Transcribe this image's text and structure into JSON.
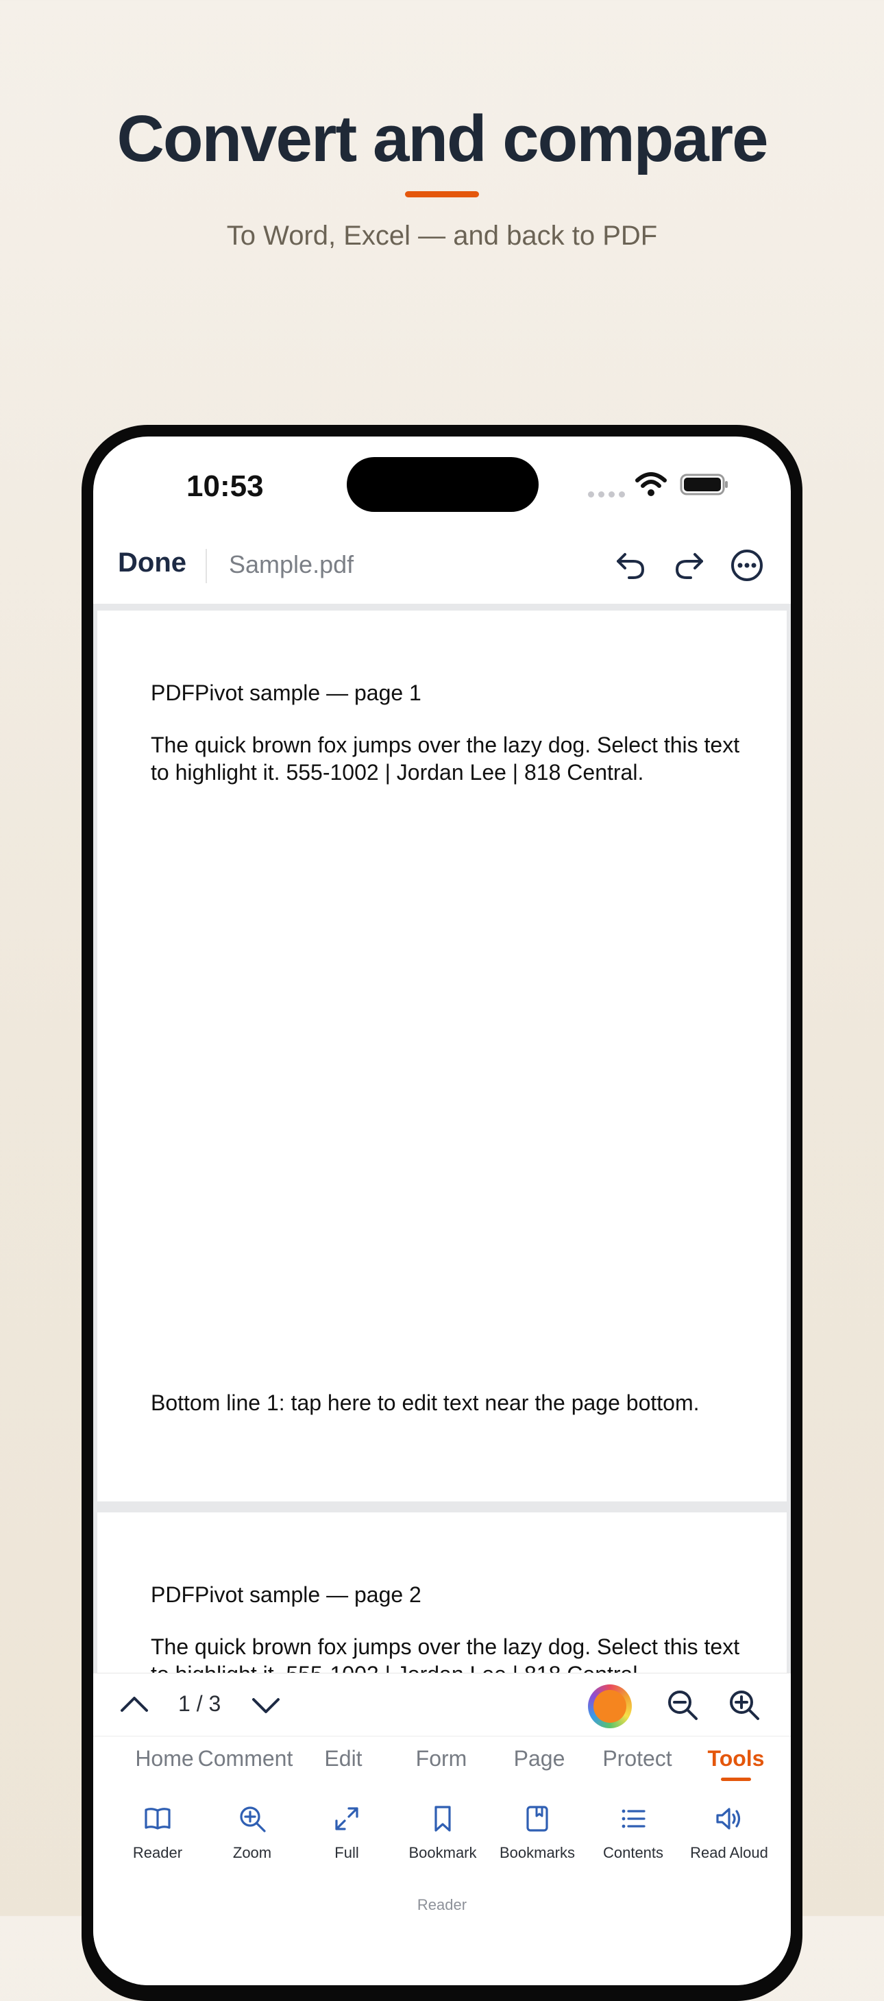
{
  "hero": {
    "title": "Convert and compare",
    "subtitle": "To Word, Excel — and back to PDF",
    "accent_color": "#e4570c"
  },
  "status_bar": {
    "time": "10:53",
    "icons": [
      "cellular-signal-icon",
      "wifi-icon",
      "battery-icon"
    ]
  },
  "topbar": {
    "done_label": "Done",
    "filename": "Sample.pdf",
    "icons": [
      "undo-icon",
      "redo-icon",
      "more-icon"
    ]
  },
  "document": {
    "pages": [
      {
        "title": "PDFPivot sample — page 1",
        "body": "The quick brown fox jumps over the lazy dog. Select this text to highlight it. 555-1002 | Jordan Lee | 818 Central.",
        "bottom": "Bottom line 1: tap here to edit text near the page bottom."
      },
      {
        "title": "PDFPivot sample — page 2",
        "body": "The quick brown fox jumps over the lazy dog. Select this text to highlight it. 555-1002 | Jordan Lee | 818 Central."
      }
    ]
  },
  "navigator": {
    "page_indicator": "1 / 3",
    "icons": [
      "chevron-up-icon",
      "chevron-down-icon",
      "color-picker-icon",
      "zoom-out-icon",
      "zoom-in-icon"
    ],
    "ink_color": "#f5851f"
  },
  "tabs": {
    "items": [
      "Home",
      "Comment",
      "Edit",
      "Form",
      "Page",
      "Protect",
      "Tools"
    ],
    "active": "Tools"
  },
  "tools": {
    "items": [
      {
        "label": "Reader",
        "icon": "book-icon"
      },
      {
        "label": "Zoom",
        "icon": "zoom-icon"
      },
      {
        "label": "Full",
        "icon": "expand-icon"
      },
      {
        "label": "Bookmark",
        "icon": "bookmark-icon"
      },
      {
        "label": "Bookmarks",
        "icon": "bookmarks-icon"
      },
      {
        "label": "Contents",
        "icon": "list-icon"
      },
      {
        "label": "Read Aloud",
        "icon": "speaker-icon"
      }
    ],
    "group_label": "Reader",
    "icon_color": "#2f5fb3"
  }
}
